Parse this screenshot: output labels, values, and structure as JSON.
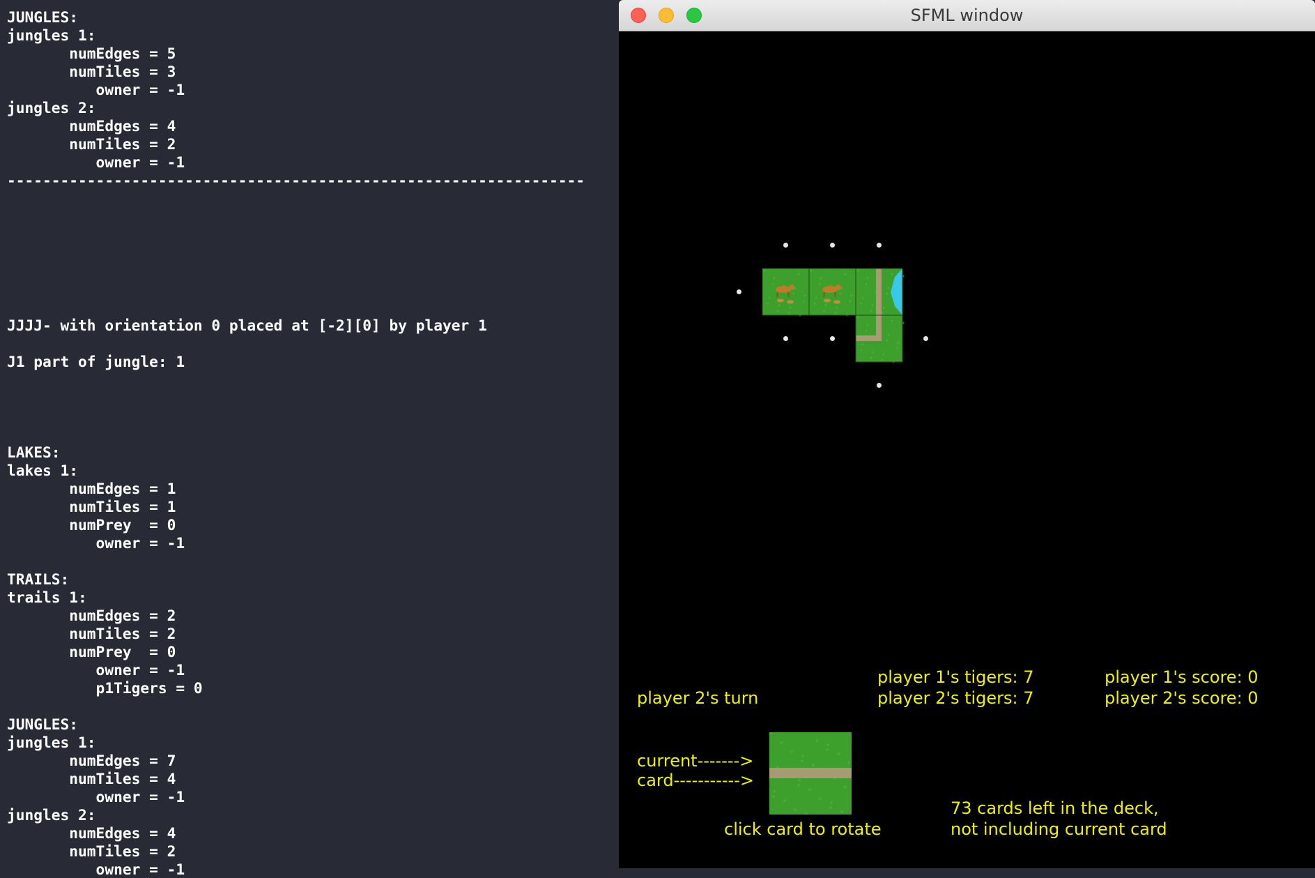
{
  "terminal": {
    "lines": [
      "JUNGLES:",
      "jungles 1:",
      "       numEdges = 5",
      "       numTiles = 3",
      "          owner = -1",
      "jungles 2:",
      "       numEdges = 4",
      "       numTiles = 2",
      "          owner = -1",
      "-----------------------------------------------------------------",
      "",
      "",
      "",
      "",
      "",
      "",
      "",
      "JJJJ- with orientation 0 placed at [-2][0] by player 1",
      "",
      "J1 part of jungle: 1",
      "",
      "",
      "",
      "",
      "LAKES:",
      "lakes 1:",
      "       numEdges = 1",
      "       numTiles = 1",
      "       numPrey  = 0",
      "          owner = -1",
      "",
      "TRAILS:",
      "trails 1:",
      "       numEdges = 2",
      "       numTiles = 2",
      "       numPrey  = 0",
      "          owner = -1",
      "          p1Tigers = 0",
      "",
      "JUNGLES:",
      "jungles 1:",
      "       numEdges = 7",
      "       numTiles = 4",
      "          owner = -1",
      "jungles 2:",
      "       numEdges = 4",
      "       numTiles = 2",
      "          owner = -1",
      "-----------------------------------------------------------------"
    ]
  },
  "window": {
    "title": "SFML window"
  },
  "board": {
    "tiles": [
      {
        "col": -2,
        "row": 0,
        "kind": "jungle-animals"
      },
      {
        "col": -1,
        "row": 0,
        "kind": "jungle-animals"
      },
      {
        "col": 0,
        "row": 0,
        "kind": "trail-lake"
      },
      {
        "col": 0,
        "row": 1,
        "kind": "trail-bend"
      }
    ],
    "open_slots": [
      {
        "col": -2,
        "row": -1
      },
      {
        "col": -1,
        "row": -1
      },
      {
        "col": 0,
        "row": -1
      },
      {
        "col": -3,
        "row": 0
      },
      {
        "col": -2,
        "row": 1
      },
      {
        "col": -1,
        "row": 1
      },
      {
        "col": 1,
        "row": 1
      },
      {
        "col": 0,
        "row": 2
      }
    ]
  },
  "hud": {
    "turn_label": "player 2's turn",
    "p1_tigers": "player 1's tigers: 7",
    "p2_tigers": "player 2's tigers: 7",
    "p1_score": "player 1's score: 0",
    "p2_score": "player 2's score: 0",
    "current_label": "current------->",
    "card_label": "card----------->",
    "rotate_hint": "click card to rotate",
    "deck_line1": "73 cards left in the deck,",
    "deck_line2": "not including current card"
  },
  "current_card": {
    "kind": "trail-straight"
  },
  "colors": {
    "grass": "#3d9f2c",
    "trail": "#a89a72",
    "lake": "#38c8e8",
    "hud_text": "#f0f000",
    "terminal_bg": "#282b36"
  }
}
